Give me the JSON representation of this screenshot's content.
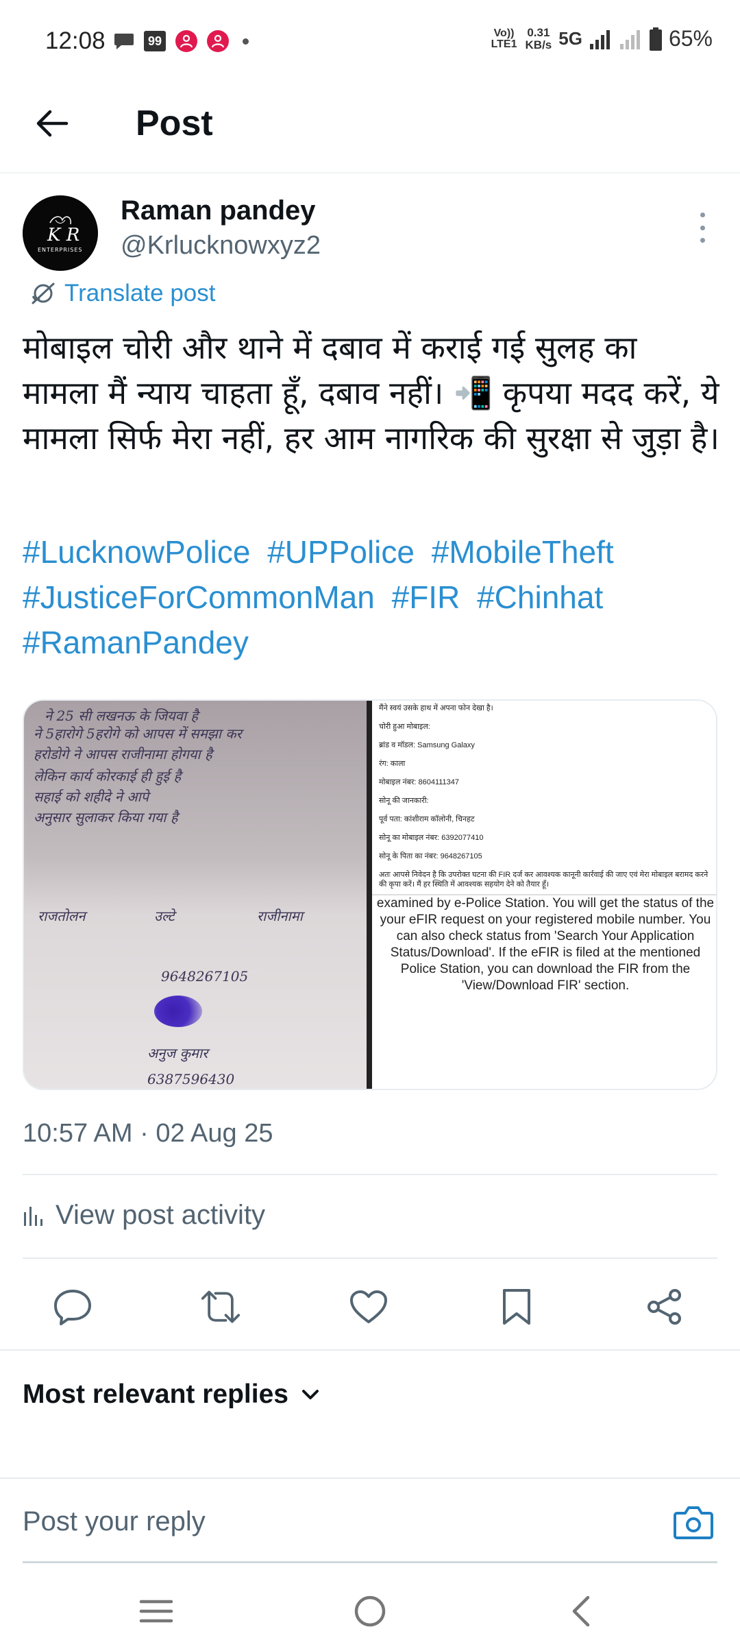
{
  "status_bar": {
    "time": "12:08",
    "badge_99": "99",
    "volte": "Vo)) LTE1",
    "speed_value": "0.31",
    "speed_unit": "KB/s",
    "network": "5G",
    "battery": "65%"
  },
  "header": {
    "title": "Post"
  },
  "post": {
    "author_name": "Raman pandey",
    "author_handle": "@Krlucknowxyz2",
    "avatar_text": "K R",
    "avatar_subtext": "ENTERPRISES",
    "translate_label": "Translate post",
    "text": "मोबाइल चोरी और थाने में दबाव में कराई गई सुलह का मामला मैं न्याय चाहता हूँ, दबाव नहीं। 📲 कृपया मदद करें, ये मामला सिर्फ मेरा नहीं, हर आम नागरिक की सुरक्षा से जुड़ा है।",
    "hashtags": [
      "#LucknowPolice",
      "#UPPolice",
      "#MobileTheft",
      "#JusticeForCommonMan",
      "#FIR",
      "#Chinhat",
      "#RamanPandey"
    ],
    "timestamp": "10:57 AM · 02 Aug 25",
    "view_activity_label": "View post activity"
  },
  "media": {
    "handwritten_lines": [
      "ने 25 सी लखनऊ के जियवा है",
      "ने 5हारोगे 5हरोगे को आपस में समझा कर",
      "हरोडोगे ने आपस राजीनामा होगया है",
      "लेकिन कार्य कोरकाई ही हुई है",
      "सहाई को शहीदे ने आपे",
      "अनुसार सुलाकर किया गया है"
    ],
    "handwritten_labels": [
      "राजतोलन",
      "उल्टे",
      "राजीनामा",
      "9648267105",
      "6387596430",
      "अनुज कुमार"
    ],
    "doc_lines": [
      "मैंने स्वयं उसके हाथ में अपना फोन देखा है।",
      "चोरी हुआ मोबाइल:",
      "ब्रांड व मॉडल: Samsung Galaxy",
      "रंग: काला",
      "मोबाइल नंबर: 8604111347",
      "सोनू की जानकारी:",
      "पूर्व पता: कांशीराम कॉलोनी, चिनहट",
      "सोनू का मोबाइल नंबर: 6392077410",
      "सोनू के पिता का नंबर: 9648267105",
      "अतः आपसे निवेदन है कि उपरोक्त घटना की FIR दर्ज कर आवश्यक कानूनी कार्रवाई की जाए एवं मेरा मोबाइल बरामद करने की कृपा करें। मैं हर स्थिति में आवश्यक सहयोग देने को तैयार हूँ।"
    ],
    "efir_text": "examined by e-Police Station. You will get the status of the your eFIR request on your registered mobile number. You can also check status from 'Search Your Application Status/Download'. If the eFIR is filed at the mentioned Police Station, you can download the FIR from the 'View/Download FIR' section."
  },
  "actions": {
    "reply": "reply-icon",
    "repost": "repost-icon",
    "like": "heart-icon",
    "bookmark": "bookmark-icon",
    "share": "share-icon"
  },
  "replies": {
    "sort_label": "Most relevant replies",
    "input_placeholder": "Post your reply"
  },
  "colors": {
    "link": "#2a8fd1",
    "secondary_text": "#536471",
    "primary_text": "#0f1419",
    "notification_red": "#e0194f"
  }
}
